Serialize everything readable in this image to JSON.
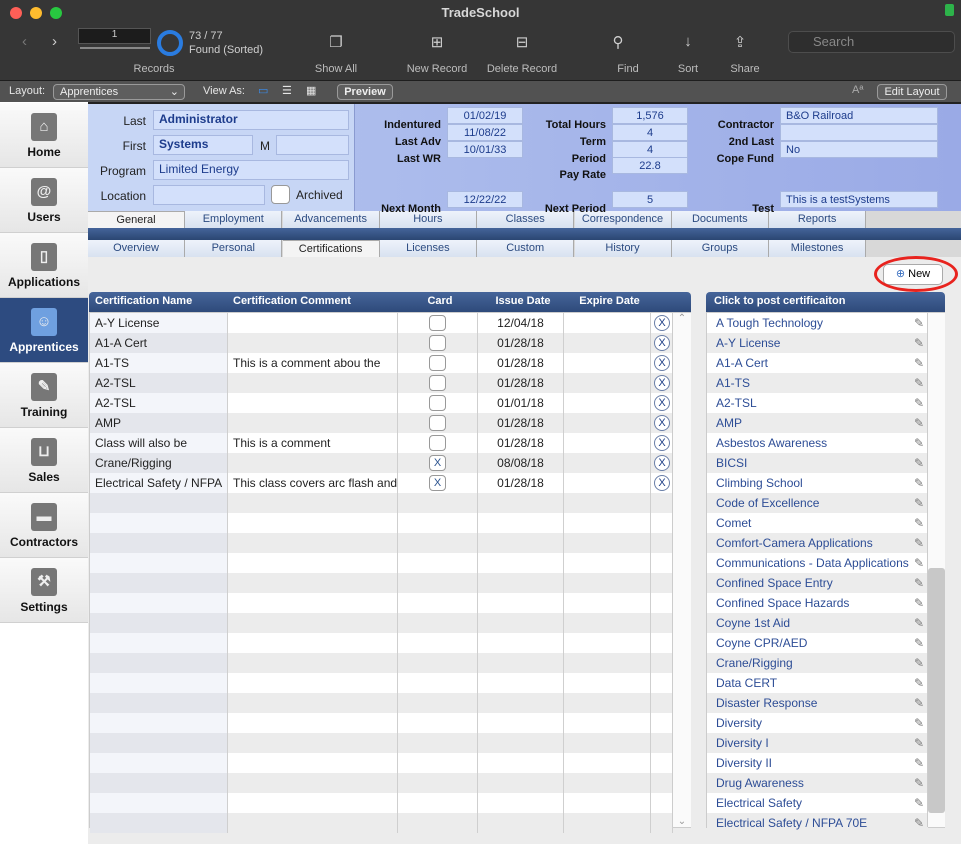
{
  "window": {
    "title": "TradeSchool"
  },
  "toolbar": {
    "record_number": "1",
    "found_count": "73 / 77",
    "found_status": "Found (Sorted)",
    "records_label": "Records",
    "show_all": "Show All",
    "new_record": "New Record",
    "delete_record": "Delete Record",
    "find": "Find",
    "sort": "Sort",
    "share": "Share",
    "search_placeholder": "Search"
  },
  "layoutbar": {
    "layout_label": "Layout:",
    "layout_value": "Apprentices",
    "view_as": "View As:",
    "preview": "Preview",
    "edit_layout": "Edit Layout"
  },
  "sidebar": {
    "items": [
      {
        "label": "Home",
        "icon": "home-icon"
      },
      {
        "label": "Users",
        "icon": "address-book-icon"
      },
      {
        "label": "Applications",
        "icon": "clipboard-icon"
      },
      {
        "label": "Apprentices",
        "icon": "id-badge-icon",
        "selected": true
      },
      {
        "label": "Training",
        "icon": "certificate-icon"
      },
      {
        "label": "Sales",
        "icon": "basket-icon"
      },
      {
        "label": "Contractors",
        "icon": "briefcase-icon"
      },
      {
        "label": "Settings",
        "icon": "tools-icon"
      }
    ]
  },
  "header": {
    "last_label": "Last",
    "last": "Administrator",
    "first_label": "First",
    "first": "Systems",
    "m_label": "M",
    "m": "",
    "program_label": "Program",
    "program": "Limited Energy",
    "location_label": "Location",
    "location": "",
    "archived_label": "Archived",
    "indentured_label": "Indentured",
    "indentured": "01/02/19",
    "last_adv_label": "Last Adv",
    "last_adv": "11/08/22",
    "last_wr_label": "Last WR",
    "last_wr": "10/01/33",
    "next_month_label": "Next Month",
    "next_month": "12/22/22",
    "total_hours_label": "Total Hours",
    "total_hours": "1,576",
    "term_label": "Term",
    "term": "4",
    "period_label": "Period",
    "period": "4",
    "pay_rate_label": "Pay Rate",
    "pay_rate": "22.8",
    "next_period_label": "Next Period",
    "next_period": "5",
    "contractor_label": "Contractor",
    "contractor": "B&O Railroad",
    "second_last_label": "2nd Last",
    "second_last": "",
    "cope_fund_label": "Cope Fund",
    "cope_fund": "No",
    "test_label": "Test",
    "test": "This is a testSystems"
  },
  "tabs1": [
    "General",
    "Employment",
    "Advancements",
    "Hours",
    "Classes",
    "Correspondence",
    "Documents",
    "Reports"
  ],
  "tabs2": [
    "Overview",
    "Personal",
    "Certifications",
    "Licenses",
    "Custom",
    "History",
    "Groups",
    "Milestones"
  ],
  "new_button": "New",
  "table": {
    "columns": [
      "Certification Name",
      "Certification Comment",
      "Card",
      "Issue Date",
      "Expire Date"
    ],
    "rows": [
      {
        "name": "A-Y License",
        "comment": "",
        "card": "",
        "issue": "12/04/18",
        "expire": ""
      },
      {
        "name": "A1-A Cert",
        "comment": "",
        "card": "",
        "issue": "01/28/18",
        "expire": ""
      },
      {
        "name": "A1-TS",
        "comment": "This is a comment abou the",
        "card": "",
        "issue": "01/28/18",
        "expire": ""
      },
      {
        "name": "A2-TSL",
        "comment": "",
        "card": "",
        "issue": "01/28/18",
        "expire": ""
      },
      {
        "name": "A2-TSL",
        "comment": "",
        "card": "",
        "issue": "01/01/18",
        "expire": ""
      },
      {
        "name": "AMP",
        "comment": "",
        "card": "",
        "issue": "01/28/18",
        "expire": ""
      },
      {
        "name": "Class will also be",
        "comment": "This is a comment",
        "card": "",
        "issue": "01/28/18",
        "expire": ""
      },
      {
        "name": "Crane/Rigging",
        "comment": "",
        "card": "X",
        "issue": "08/08/18",
        "expire": ""
      },
      {
        "name": "Electrical Safety / NFPA",
        "comment": "This class covers arc flash and",
        "card": "X",
        "issue": "01/28/18",
        "expire": ""
      }
    ]
  },
  "postlist": {
    "header": "Click to post certificaiton",
    "items": [
      "A Tough Technology",
      "A-Y License",
      "A1-A Cert",
      "A1-TS",
      "A2-TSL",
      "AMP",
      "Asbestos Awareness",
      "BICSI",
      "Climbing School",
      "Code of Excellence",
      "Comet",
      "Comfort-Camera Applications",
      "Communications - Data Applications",
      "Confined Space Entry",
      "Confined Space Hazards",
      "Coyne 1st Aid",
      "Coyne CPR/AED",
      "Crane/Rigging",
      "Data CERT",
      "Disaster Response",
      "Diversity",
      "Diversity I",
      "Diversity II",
      "Drug Awareness",
      "Electrical Safety",
      "Electrical Safety / NFPA 70E"
    ]
  },
  "colors": {
    "accent": "#2d4b80",
    "annotation": "#e8231e"
  }
}
